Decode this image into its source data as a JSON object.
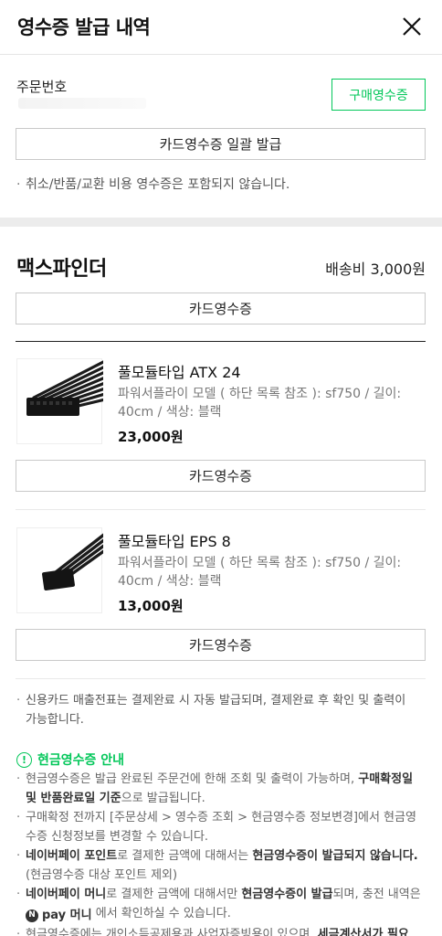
{
  "header": {
    "title": "영수증 발급 내역"
  },
  "order": {
    "label": "주문번호",
    "purchase_receipt_label": "구매영수증",
    "bulk_card_receipt_label": "카드영수증 일괄 발급",
    "note": "취소/반품/교환 비용 영수증은 포함되지 않습니다."
  },
  "seller": {
    "name": "맥스파인더",
    "shipping": "배송비 3,000원",
    "card_receipt_label": "카드영수증"
  },
  "products": [
    {
      "name": "풀모듈타입 ATX 24",
      "option_line1": "파워서플라이 모델 ( 하단 목록 참조 ): sf750 / 길이:",
      "option_line2": "40cm / 색상: 블랙",
      "price": "23,000원",
      "card_receipt_label": "카드영수증"
    },
    {
      "name": "풀모듈타입 EPS 8",
      "option_line1": "파워서플라이 모델 ( 하단 목록 참조 ): sf750 / 길이:",
      "option_line2": "40cm / 색상: 블랙",
      "price": "13,000원",
      "card_receipt_label": "카드영수증"
    }
  ],
  "credit_note_line1": "신용카드 매출전표는 결제완료 시 자동 발급되며, 결제완료 후 확인 및 출력이",
  "credit_note_line2": "가능합니다.",
  "cash_info": {
    "title": "현금영수증 안내",
    "item1_a": "현금영수증은 발급 완료된 주문건에 한해 조회 및 출력이 가능하며, ",
    "item1_b": "구매확정일 및 반품완료일 기준",
    "item1_c": "으로 발급됩니다.",
    "item2": "구매확정 전까지 [주문상세 > 영수증 조회 > 현금영수증 정보변경]에서 현금영수증 신청정보를 변경할 수 있습니다.",
    "item3_a": "네이버페이 포인트",
    "item3_b": "로 결제한 금액에 대해서는 ",
    "item3_c": "현금영수증이 발급되지 않습니다.",
    "item3_d": "(현금영수증 대상 포인트 제외)",
    "item4_a": "네이버페이 머니",
    "item4_b": "로 결제한 금액에 대해서만 ",
    "item4_c": "현금영수증이 발급",
    "item4_d": "되며, 충전 내역은 ",
    "item4_npay": "pay 머니",
    "item4_e": " 에서 확인하실 수 있습니다.",
    "item5_a": "현금영수증에는 개인소득공제용과 사업자증빙용이 있으며, ",
    "item5_b": "세금계산서가 필요"
  },
  "colors": {
    "accent": "#03c75a",
    "text": "#111111",
    "muted": "#777777"
  }
}
